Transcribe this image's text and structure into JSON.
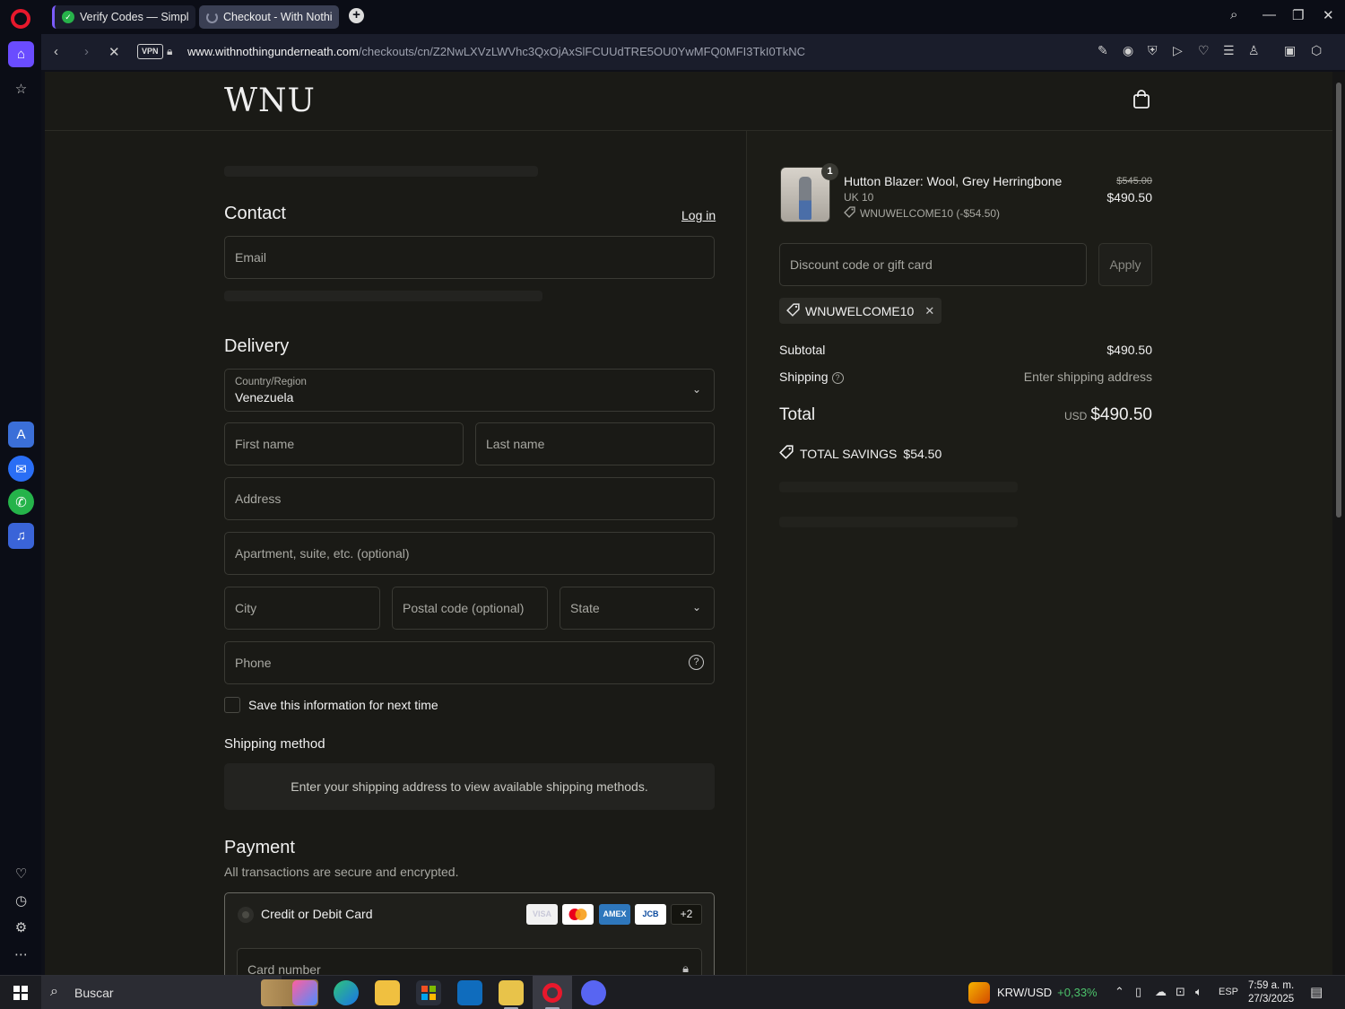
{
  "browser": {
    "tabs": [
      {
        "label": "Verify Codes — SimplyCodes"
      },
      {
        "label": "Checkout - With Nothing Underneath"
      }
    ],
    "new_tab": "+",
    "vpn_label": "VPN",
    "url_host": "www.withnothingunderneath.com",
    "url_path": "/checkouts/cn/Z2NwLXVzLWVhc3QxOjAxSlFCUUdTRE5OU0YwMFQ0MFI3TkI0TkNC"
  },
  "store": {
    "logo": "WNU"
  },
  "contact": {
    "title": "Contact",
    "login_link": "Log in",
    "email_placeholder": "Email"
  },
  "delivery": {
    "title": "Delivery",
    "country_label": "Country/Region",
    "country_value": "Venezuela",
    "first_name": "First name",
    "last_name": "Last name",
    "address": "Address",
    "apartment": "Apartment, suite, etc. (optional)",
    "city": "City",
    "postal": "Postal code (optional)",
    "state": "State",
    "phone": "Phone",
    "save_info": "Save this information for next time"
  },
  "shipping_method": {
    "title": "Shipping method",
    "message": "Enter your shipping address to view available shipping methods."
  },
  "payment": {
    "title": "Payment",
    "subtitle": "All transactions are secure and encrypted.",
    "method_label": "Credit or Debit Card",
    "cards": [
      "VISA",
      "MC",
      "AMEX",
      "JCB"
    ],
    "more_cards": "+2",
    "card_number": "Card number"
  },
  "summary": {
    "item": {
      "quantity": "1",
      "name": "Hutton Blazer: Wool, Grey Herringbone",
      "variant": "UK 10",
      "discount": "WNUWELCOME10 (-$54.50)",
      "price_original": "$545.00",
      "price_final": "$490.50"
    },
    "discount_placeholder": "Discount code or gift card",
    "apply_label": "Apply",
    "applied_code": "WNUWELCOME10",
    "subtotal_label": "Subtotal",
    "subtotal_value": "$490.50",
    "shipping_label": "Shipping",
    "shipping_value": "Enter shipping address",
    "total_label": "Total",
    "total_currency": "USD",
    "total_value": "$490.50",
    "savings_label": "TOTAL SAVINGS",
    "savings_value": "$54.50"
  },
  "taskbar": {
    "search_text": "Buscar",
    "ticker_pair": "KRW/USD",
    "ticker_change": "+0,33%",
    "language": "ESP",
    "time": "7:59 a. m.",
    "date": "27/3/2025"
  },
  "colors": {
    "page_bg": "#1a1a16",
    "summary_bg": "#1c1c17",
    "browser_bg": "#0b0d16",
    "opera_red": "#e8182c",
    "accent_purple": "#6a4cff",
    "ticker_green": "#4cc26b"
  }
}
